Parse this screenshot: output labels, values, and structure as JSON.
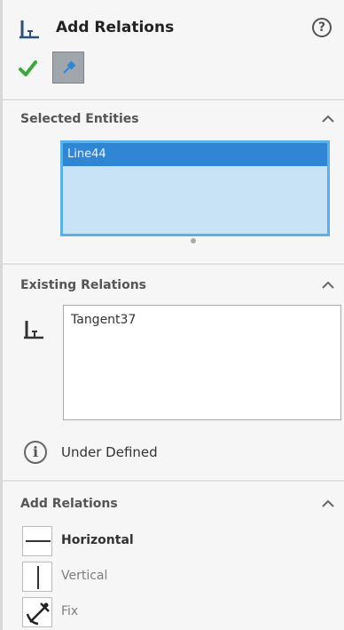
{
  "header": {
    "title": "Add Relations",
    "icons": {
      "title": "add-relation-icon",
      "help": "help-icon",
      "ok": "checkmark-icon",
      "pin": "pushpin-icon"
    },
    "help_glyph": "?"
  },
  "selected_entities": {
    "title": "Selected Entities",
    "items": [
      "Line44"
    ]
  },
  "existing_relations": {
    "title": "Existing Relations",
    "items": [
      "Tangent37"
    ],
    "status_icon": "info-icon",
    "status_text": "Under Defined"
  },
  "add_relations": {
    "title": "Add Relations",
    "buttons": [
      {
        "label": "Horizontal",
        "icon": "horizontal-icon"
      },
      {
        "label": "Vertical",
        "icon": "vertical-icon"
      },
      {
        "label": "Fix",
        "icon": "fix-anchor-icon"
      }
    ]
  },
  "colors": {
    "selection": "#2f86d5",
    "selection_box": "#c9e3f6",
    "selection_border": "#58b1e8",
    "check": "#3aa83a"
  }
}
